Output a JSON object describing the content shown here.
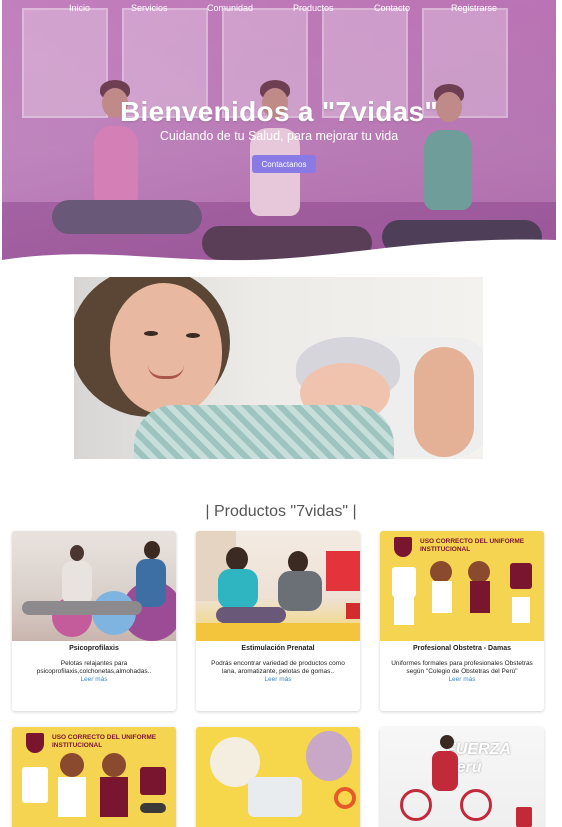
{
  "nav": {
    "items": [
      "Inicio",
      "Servicios",
      "Comunidad",
      "Productos",
      "Contacto",
      "Registrarse"
    ]
  },
  "hero": {
    "title": "Bienvenidos a \"7vidas\"",
    "subtitle": "Cuidando de tu Salud, para mejorar tu vida",
    "cta_label": "Contactanos"
  },
  "products": {
    "section_title": "| Productos \"7vidas\" |",
    "read_more_label": "Leer más",
    "cards": [
      {
        "title": "Psicoprofilaxis",
        "description": "Pelotas relajantes para psicoprofilaxis,colchonetas,almohadas.."
      },
      {
        "title": "Estimulación Prenatal",
        "description": "Podrás encontrar variedad de productos como lana, aromatizante, pelotas de gomas.."
      },
      {
        "title": "Profesional Obstetra - Damas",
        "description": "Uniformes formales para profesionales Obstetras según \"Colegio de Obstetras del Perú\"",
        "banner": "USO CORRECTO DEL UNIFORME INSTITUCIONAL"
      }
    ],
    "second_row": [
      {
        "banner": "USO CORRECTO DEL UNIFORME INSTITUCIONAL"
      },
      {
        "banner": ""
      },
      {
        "banner": "FUERZA Perú"
      }
    ]
  },
  "colors": {
    "hero_overlay": "#b050aa",
    "cta": "#8a7ae6",
    "link": "#3c86c8",
    "banner_text": "#7a1530",
    "poster_yellow": "#f4d450"
  }
}
